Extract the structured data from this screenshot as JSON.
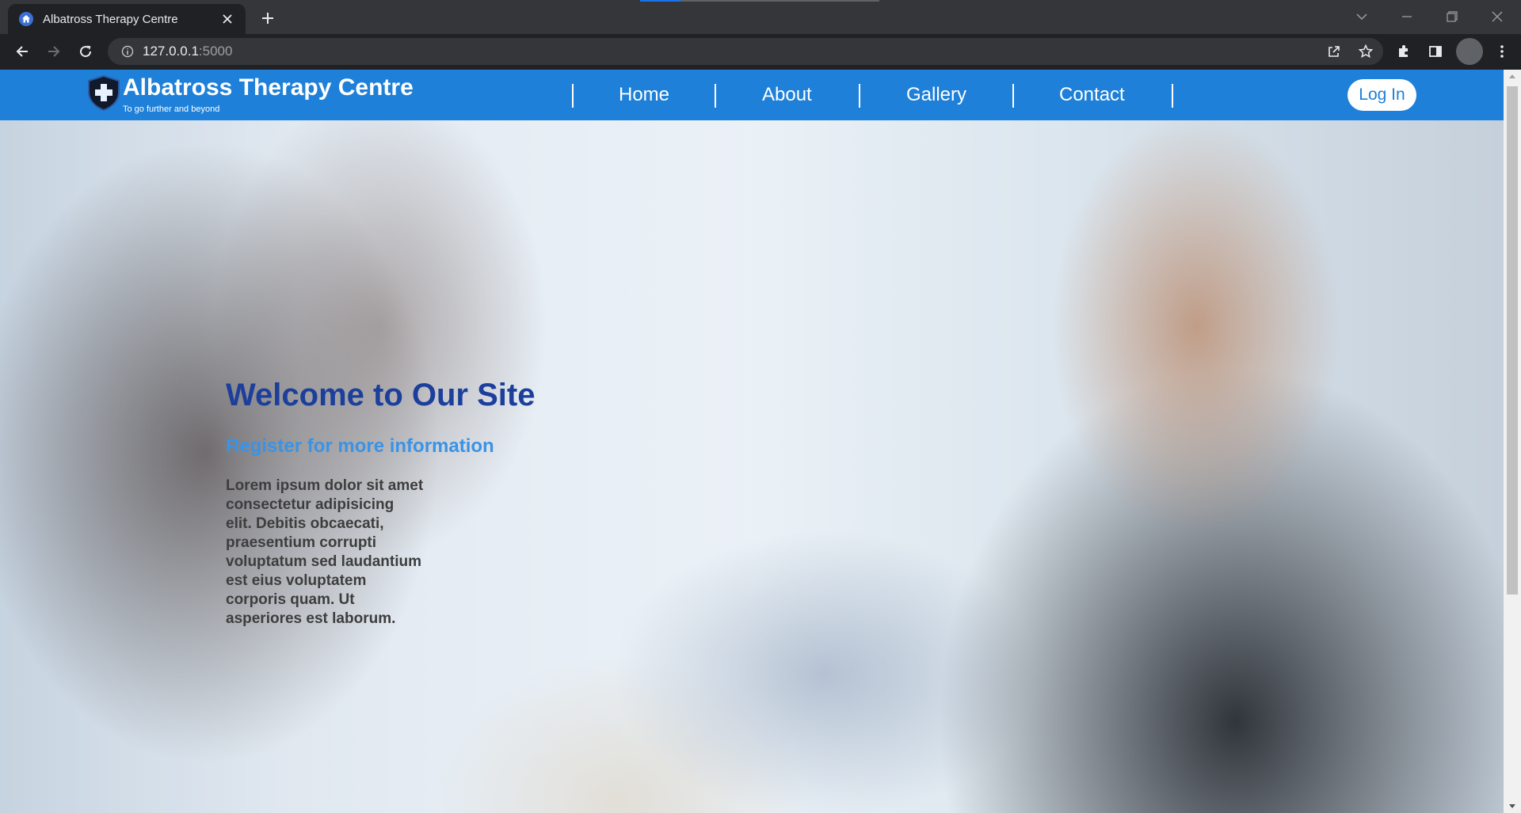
{
  "browser": {
    "tab_title": "Albatross Therapy Centre",
    "load_progress": 0.17,
    "url_host": "127.0.0.1",
    "url_port": ":5000",
    "icons": [
      "home-favicon-icon",
      "close-icon",
      "plus-icon",
      "chevron-down-icon",
      "minimize-icon",
      "restore-icon",
      "close-window-icon",
      "back-icon",
      "forward-icon",
      "reload-icon",
      "info-icon",
      "share-icon",
      "star-icon",
      "extensions-icon",
      "sidebar-icon",
      "more-icon"
    ]
  },
  "navbar": {
    "brand_name": "Albatross Therapy Centre",
    "brand_tagline": "To go further and beyond",
    "links": [
      {
        "label": "Home"
      },
      {
        "label": "About"
      },
      {
        "label": "Gallery"
      },
      {
        "label": "Contact"
      }
    ],
    "login_label": "Log In",
    "color": "#1e80d8"
  },
  "hero": {
    "title": "Welcome to Our Site",
    "subtitle": "Register for more information",
    "body": "Lorem ipsum dolor sit amet consectetur adipisicing elit. Debitis obcaecati, praesentium corrupti voluptatum sed laudantium est eius voluptatem corporis quam. Ut asperiores est laborum.",
    "title_color": "#1c3f9c",
    "subtitle_color": "#3a93e6"
  }
}
